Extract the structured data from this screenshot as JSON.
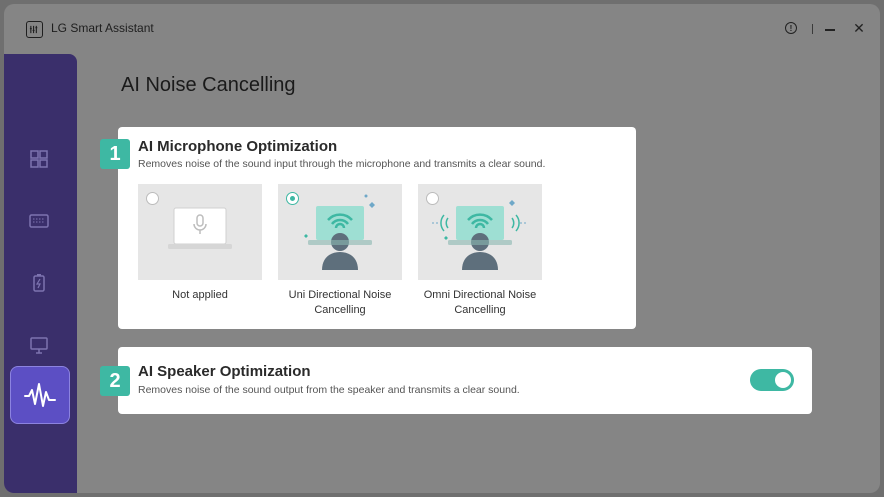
{
  "window": {
    "app_title": "LG Smart Assistant"
  },
  "page": {
    "title": "AI Noise Cancelling"
  },
  "mic_section": {
    "badge": "1",
    "title": "AI Microphone Optimization",
    "description": "Removes noise of the sound input through the microphone and transmits a clear sound.",
    "options": [
      {
        "label": "Not applied",
        "selected": false
      },
      {
        "label": "Uni Directional Noise Cancelling",
        "selected": true
      },
      {
        "label": "Omni Directional Noise Cancelling",
        "selected": false
      }
    ]
  },
  "speaker_section": {
    "badge": "2",
    "title": "AI Speaker Optimization",
    "description": "Removes noise of the sound output from the speaker and transmits a clear sound.",
    "toggle_on": true
  },
  "sidebar": {
    "items": [
      {
        "icon": "dashboard-icon"
      },
      {
        "icon": "keyboard-icon"
      },
      {
        "icon": "battery-icon"
      },
      {
        "icon": "monitor-icon"
      },
      {
        "icon": "sound-wave-icon",
        "active": true
      }
    ]
  },
  "colors": {
    "accent": "#3eb8a3",
    "sidebar": "#3a2f6b",
    "sidebar_active": "#5c4fc4"
  }
}
